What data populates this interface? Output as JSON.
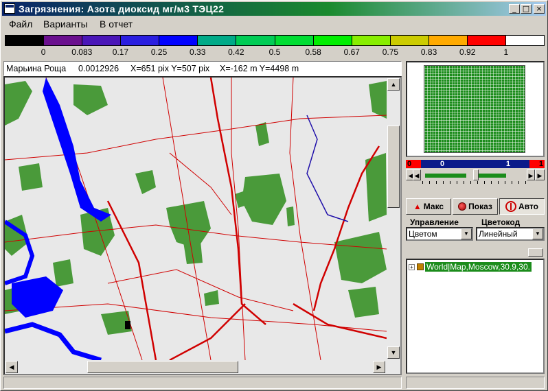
{
  "window": {
    "title": "Загрязнения: Азота диоксид  мг/м3  ТЭЦ22",
    "icon": "window-app-icon",
    "controls": {
      "minimize": "_",
      "maximize": "□",
      "close": "×"
    }
  },
  "menu": [
    "Файл",
    "Варианты",
    "В отчет"
  ],
  "scale": {
    "colors": [
      "#000000",
      "#6a0f8e",
      "#4a16b8",
      "#2a1ee0",
      "#0000ff",
      "#00aa88",
      "#00cc55",
      "#00dd33",
      "#00ee00",
      "#88ee00",
      "#cccc00",
      "#ffaa00",
      "#ff0000",
      "#ffffff"
    ],
    "labels": [
      "0",
      "0.083",
      "0.17",
      "0.25",
      "0.33",
      "0.42",
      "0.5",
      "0.58",
      "0.67",
      "0.75",
      "0.83",
      "0.92",
      "1"
    ]
  },
  "info": {
    "place": "Марьина Роща",
    "value": "0.0012926",
    "pix": "X=651 pix Y=507 pix",
    "meters": "X=-162 m Y=4498 m"
  },
  "colors": {
    "map_bg": "#e8e8e8",
    "green_area": "#4a9a3a",
    "water": "#0000ff",
    "roads": "#d00000",
    "preview_grid": "#1b8c1b"
  },
  "panel": {
    "range": {
      "left": "0",
      "mid_start": "0",
      "mid_end": "1",
      "right": "1"
    },
    "buttons": {
      "max": "Макс",
      "show": "Показ",
      "auto": "Авто"
    },
    "control_label": "Управление",
    "colorcode_label": "Цветокод",
    "control_value": "Цветом",
    "colorcode_value": "Линейный",
    "tree_item": "World|Map,Moscow,30.9,30."
  },
  "icons": [
    "up-arrow-icon",
    "red-dot-icon",
    "gauge-icon",
    "tree-expand-icon",
    "layer-icon"
  ]
}
